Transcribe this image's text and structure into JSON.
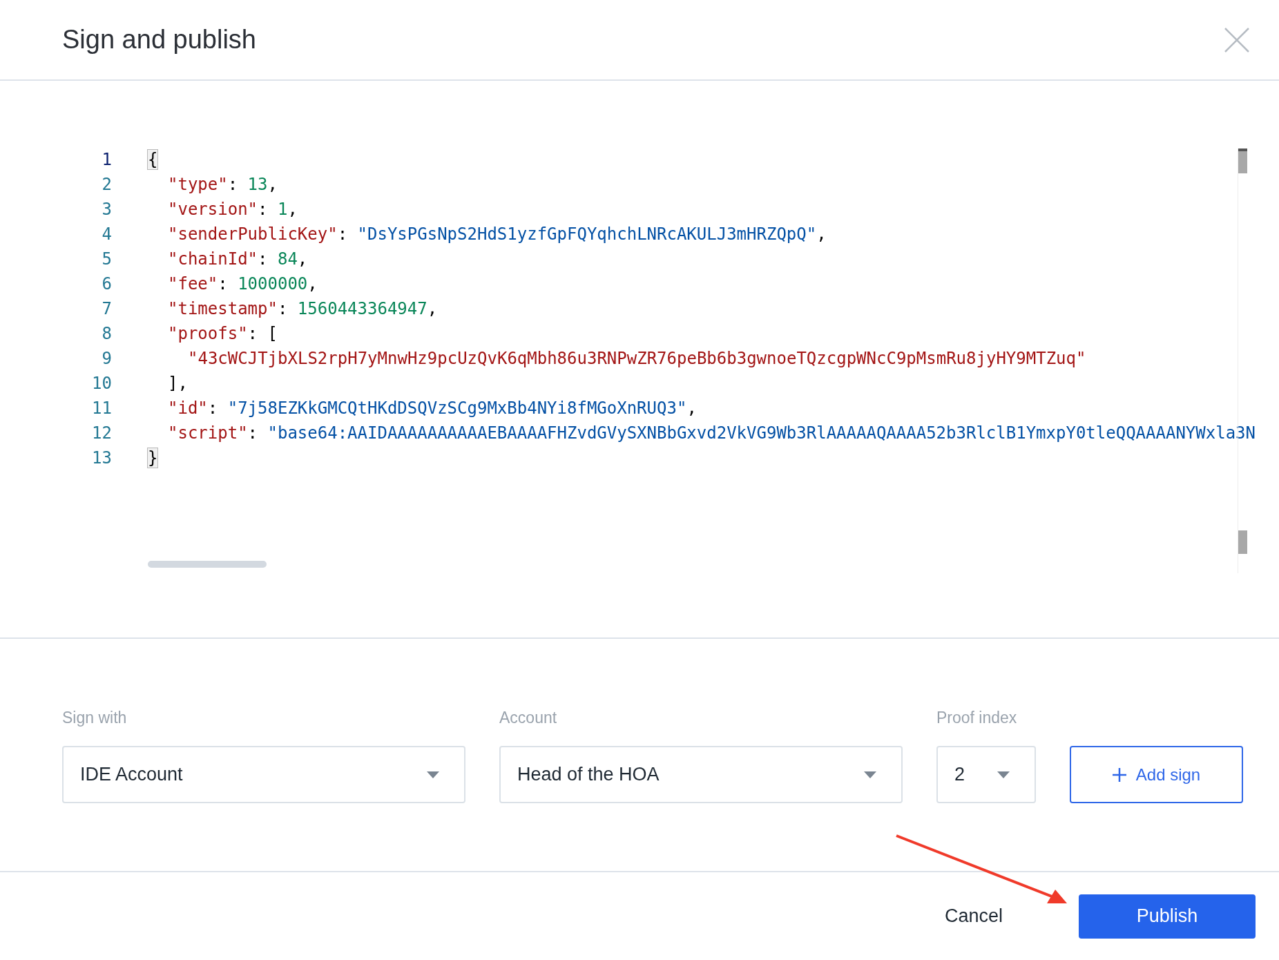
{
  "dialog": {
    "title": "Sign and publish"
  },
  "editor": {
    "lines": [
      {
        "number": "1",
        "active": true,
        "tokens": [
          {
            "kind": "bracket",
            "text": "{"
          }
        ],
        "children": [
          {
            "number": "2",
            "active": false,
            "tokens": [
              {
                "kind": "key",
                "text": "\"type\""
              },
              {
                "kind": "punct",
                "text": ": "
              },
              {
                "kind": "number",
                "text": "13"
              },
              {
                "kind": "punct",
                "text": ","
              }
            ]
          },
          {
            "number": "3",
            "active": false,
            "tokens": [
              {
                "kind": "key",
                "text": "\"version\""
              },
              {
                "kind": "punct",
                "text": ": "
              },
              {
                "kind": "number",
                "text": "1"
              },
              {
                "kind": "punct",
                "text": ","
              }
            ]
          },
          {
            "number": "4",
            "active": false,
            "tokens": [
              {
                "kind": "key",
                "text": "\"senderPublicKey\""
              },
              {
                "kind": "punct",
                "text": ": "
              },
              {
                "kind": "string",
                "text": "\"DsYsPGsNpS2HdS1yzfGpFQYqhchLNRcAKULJ3mHRZQpQ\""
              },
              {
                "kind": "punct",
                "text": ","
              }
            ]
          },
          {
            "number": "5",
            "active": false,
            "tokens": [
              {
                "kind": "key",
                "text": "\"chainId\""
              },
              {
                "kind": "punct",
                "text": ": "
              },
              {
                "kind": "number",
                "text": "84"
              },
              {
                "kind": "punct",
                "text": ","
              }
            ]
          },
          {
            "number": "6",
            "active": false,
            "tokens": [
              {
                "kind": "key",
                "text": "\"fee\""
              },
              {
                "kind": "punct",
                "text": ": "
              },
              {
                "kind": "number",
                "text": "1000000"
              },
              {
                "kind": "punct",
                "text": ","
              }
            ]
          },
          {
            "number": "7",
            "active": false,
            "tokens": [
              {
                "kind": "key",
                "text": "\"timestamp\""
              },
              {
                "kind": "punct",
                "text": ": "
              },
              {
                "kind": "number",
                "text": "1560443364947"
              },
              {
                "kind": "punct",
                "text": ","
              }
            ]
          },
          {
            "number": "8",
            "active": false,
            "tokens": [
              {
                "kind": "key",
                "text": "\"proofs\""
              },
              {
                "kind": "punct",
                "text": ": ["
              }
            ],
            "children": [
              {
                "number": "9",
                "active": false,
                "tokens": [
                  {
                    "kind": "key",
                    "text": "\"43cWCJTjbXLS2rpH7yMnwHz9pcUzQvK6qMbh86u3RNPwZR76peBb6b3gwnoeTQzcgpWNcC9pMsmRu8jyHY9MTZuq\""
                  }
                ]
              }
            ]
          },
          {
            "number": "10",
            "active": false,
            "tokens": [
              {
                "kind": "punct",
                "text": "],"
              }
            ]
          },
          {
            "number": "11",
            "active": false,
            "tokens": [
              {
                "kind": "key",
                "text": "\"id\""
              },
              {
                "kind": "punct",
                "text": ": "
              },
              {
                "kind": "string",
                "text": "\"7j58EZKkGMCQtHKdDSQVzSCg9MxBb4NYi8fMGoXnRUQ3\""
              },
              {
                "kind": "punct",
                "text": ","
              }
            ]
          },
          {
            "number": "12",
            "active": false,
            "tokens": [
              {
                "kind": "key",
                "text": "\"script\""
              },
              {
                "kind": "punct",
                "text": ": "
              },
              {
                "kind": "string",
                "text": "\"base64:AAIDAAAAAAAAAAEBAAAAFHZvdGVySXNBbGxvd2VkVG9Wb3RlAAAAAQAAAA52b3RlclB1YmxpY0tleQQAAAANYWxla3N"
              }
            ]
          }
        ]
      },
      {
        "number": "13",
        "active": false,
        "tokens": [
          {
            "kind": "bracket",
            "text": "}"
          }
        ]
      }
    ]
  },
  "fields": [
    {
      "kind": "select",
      "label": "Sign with",
      "value": "IDE Account"
    },
    {
      "kind": "select",
      "label": "Account",
      "value": "Head of the HOA"
    },
    {
      "kind": "select-small",
      "label": "Proof index",
      "value": "2"
    }
  ],
  "add_sign_button": "Add sign",
  "footer": {
    "cancel": "Cancel",
    "publish": "Publish"
  }
}
